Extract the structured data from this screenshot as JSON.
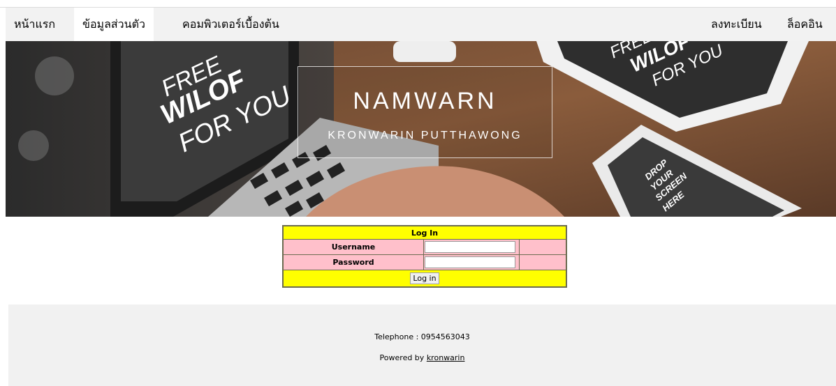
{
  "nav": {
    "left": [
      {
        "label": "หน้าแรก",
        "active": false
      },
      {
        "label": "ข้อมูลส่วนตัว",
        "active": true
      },
      {
        "label": "คอมพิวเตอร์เบื้องต้น",
        "active": false
      }
    ],
    "right": [
      {
        "label": "ลงทะเบียน"
      },
      {
        "label": "ล็อคอิน"
      }
    ]
  },
  "hero": {
    "title": "NAMWARN",
    "subtitle": "KRONWARIN PUTTHAWONG",
    "laptop_text": [
      "FREE",
      "WILOF",
      "FOR YOU"
    ],
    "tablet_text": [
      "FREE",
      "WILOF",
      "FOR YOU"
    ],
    "phone_text": [
      "DROP",
      "YOUR",
      "SCREEN",
      "HERE"
    ]
  },
  "login": {
    "header": "Log In",
    "username_label": "Username",
    "password_label": "Password",
    "username_value": "",
    "password_value": "",
    "button_label": "Log in"
  },
  "footer": {
    "telephone": "Telephone : 0954563043",
    "powered_prefix": "Powered by",
    "powered_link": "kronwarin"
  }
}
